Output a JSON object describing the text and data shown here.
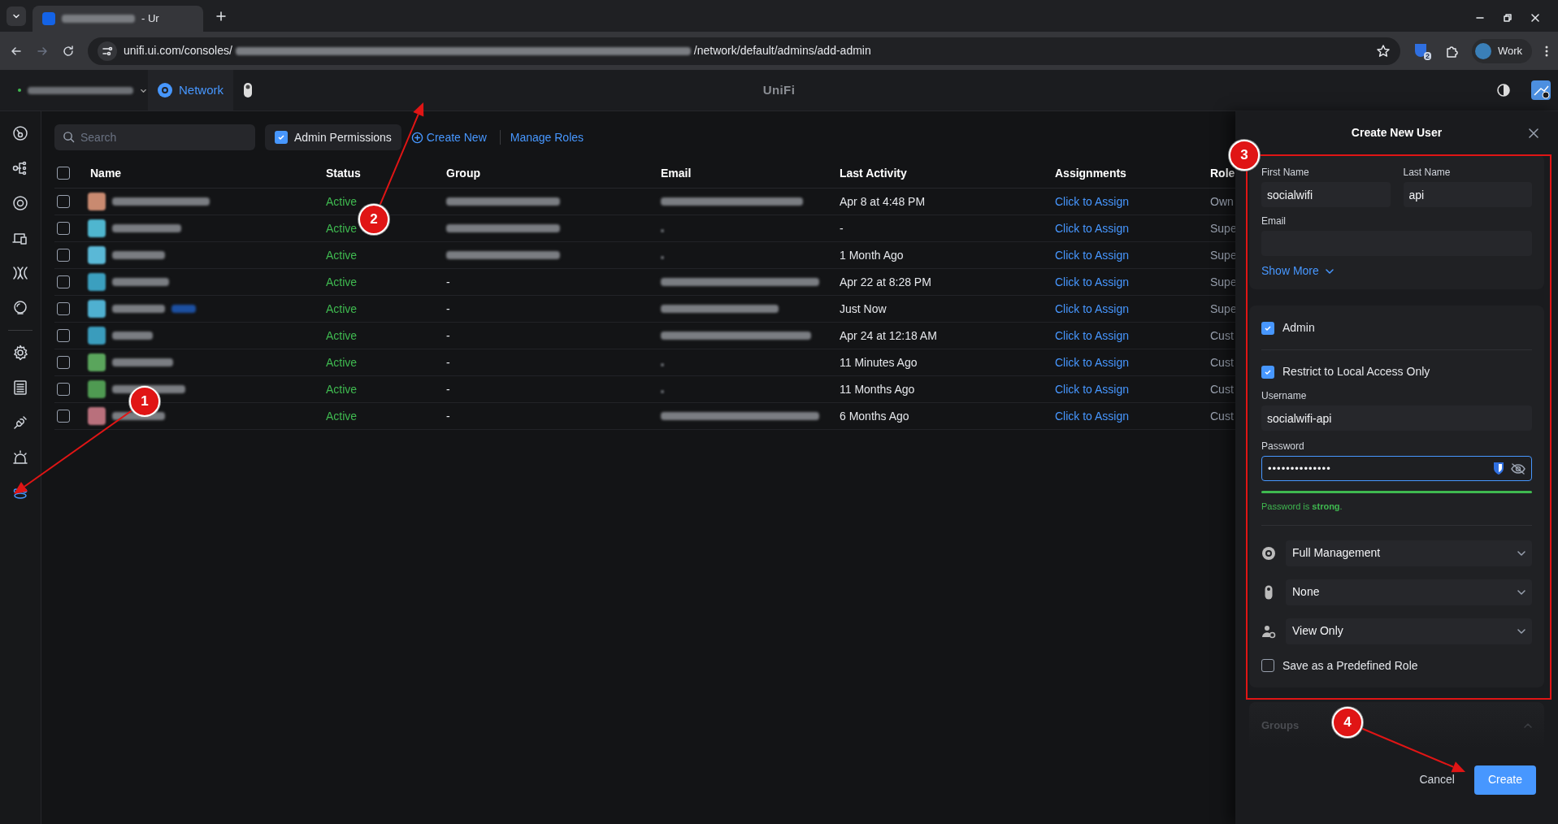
{
  "browser": {
    "tab_title": "- Ur",
    "url_start": "unifi.ui.com/consoles/",
    "url_end": "/network/default/admins/add-admin",
    "extension_badge": "2",
    "profile": "Work"
  },
  "app_header": {
    "app_tab": "Network",
    "brand": "UniFi"
  },
  "sidebar": {
    "items": [
      {
        "selected": false
      },
      {
        "selected": false
      },
      {
        "selected": false
      },
      {
        "selected": false
      },
      {
        "selected": false
      },
      {
        "selected": false
      },
      {
        "selected": false
      },
      {
        "selected": false
      },
      {
        "selected": false
      },
      {
        "selected": false
      },
      {
        "selected": true
      }
    ]
  },
  "toolbar": {
    "search": {
      "placeholder": "Search"
    },
    "admin_permissions": {
      "label": "Admin Permissions",
      "checked": true
    },
    "create_new": "Create New",
    "manage_roles": "Manage Roles"
  },
  "table": {
    "select_all_checked": false,
    "columns": [
      "Name",
      "Status",
      "Group",
      "Email",
      "Last Activity",
      "Assignments",
      "Role"
    ],
    "rows": [
      {
        "color": "#c98a70",
        "checked": false,
        "status": "Active",
        "last_activity": "Apr 8 at 4:48 PM",
        "assignment": "Click to Assign",
        "role": "Own"
      },
      {
        "color": "#4fb6cf",
        "checked": false,
        "status": "Active",
        "last_activity": "-",
        "assignment": "Click to Assign",
        "role": "Supe"
      },
      {
        "color": "#5ab8d6",
        "checked": false,
        "status": "Active",
        "last_activity": "1 Month Ago",
        "assignment": "Click to Assign",
        "role": "Supe"
      },
      {
        "color": "#3b9fbf",
        "checked": false,
        "status": "Active",
        "group": "-",
        "last_activity": "Apr 22 at 8:28 PM",
        "assignment": "Click to Assign",
        "role": "Supe"
      },
      {
        "color": "#4fb0d0",
        "checked": false,
        "status": "Active",
        "group": "-",
        "last_activity": "Just Now",
        "assignment": "Click to Assign",
        "role": "Supe"
      },
      {
        "color": "#3a9cbc",
        "checked": false,
        "status": "Active",
        "group": "-",
        "last_activity": "Apr 24 at 12:18 AM",
        "assignment": "Click to Assign",
        "role": "Cust"
      },
      {
        "color": "#5aa55c",
        "checked": false,
        "status": "Active",
        "group": "-",
        "last_activity": "11 Minutes Ago",
        "assignment": "Click to Assign",
        "role": "Cust"
      },
      {
        "color": "#4f9a52",
        "checked": false,
        "status": "Active",
        "group": "-",
        "last_activity": "11 Months Ago",
        "assignment": "Click to Assign",
        "role": "Cust"
      },
      {
        "color": "#b9707c",
        "checked": false,
        "status": "Active",
        "group": "-",
        "last_activity": "6 Months Ago",
        "assignment": "Click to Assign",
        "role": "Cust"
      }
    ]
  },
  "panel": {
    "title": "Create New User",
    "first_name": {
      "label": "First Name",
      "value": "socialwifi"
    },
    "last_name": {
      "label": "Last Name",
      "value": "api"
    },
    "email": {
      "label": "Email"
    },
    "show_more": "Show More",
    "admin": {
      "label": "Admin",
      "checked": true
    },
    "restrict_local": {
      "label": "Restrict to Local Access Only",
      "checked": true
    },
    "username": {
      "label": "Username",
      "value": "socialwifi-api"
    },
    "password": {
      "label": "Password",
      "value": "••••••••••••••",
      "level": 1,
      "hint": "Password is **strong**."
    },
    "roles": [
      {
        "value": "Full Management"
      },
      {
        "value": "None"
      },
      {
        "value": "View Only"
      }
    ],
    "save_predefined": {
      "label": "Save as a Predefined Role",
      "checked": false
    },
    "groups": "Groups",
    "cancel": "Cancel",
    "create": "Create"
  },
  "annotations": [
    {
      "label": "1"
    },
    {
      "label": "2"
    },
    {
      "label": "3"
    },
    {
      "label": "4"
    }
  ]
}
